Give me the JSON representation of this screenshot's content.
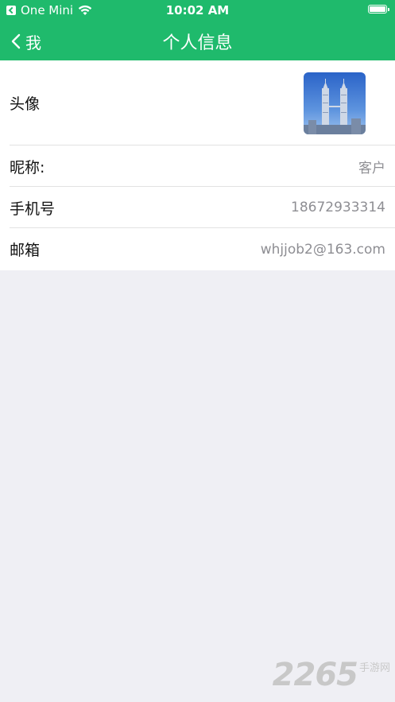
{
  "status_bar": {
    "carrier": "One Mini",
    "time": "10:02 AM"
  },
  "nav": {
    "back_label": "我",
    "title": "个人信息"
  },
  "profile_rows": [
    {
      "label": "头像",
      "value": ""
    },
    {
      "label": "昵称:",
      "value": "客户"
    },
    {
      "label": "手机号",
      "value": "18672933314"
    },
    {
      "label": "邮箱",
      "value": "whjjob2@163.com"
    }
  ],
  "watermark": {
    "number": "2265",
    "text": "手游网"
  },
  "colors": {
    "header_bg": "#1fba6c",
    "page_bg": "#efeff4",
    "value_text": "#8e8e93"
  },
  "icons": [
    "back-app-icon",
    "wifi-icon",
    "battery-icon",
    "back-chevron-icon"
  ]
}
